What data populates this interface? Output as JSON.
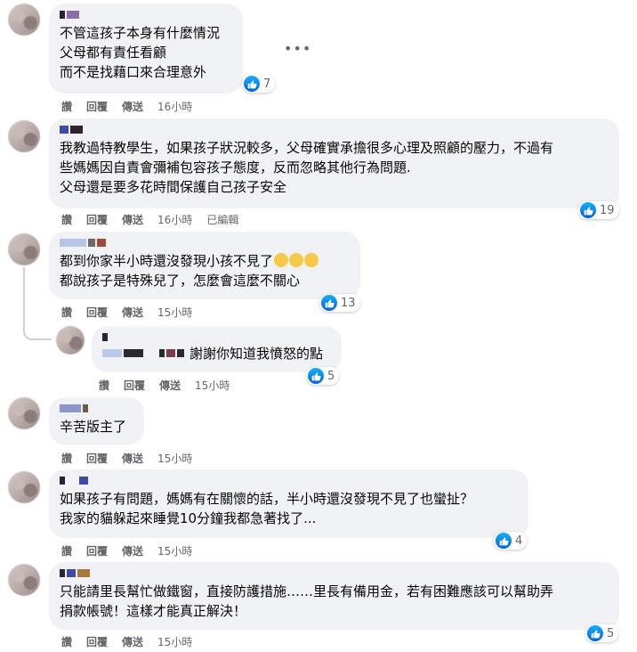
{
  "actions": {
    "like": "讚",
    "reply": "回覆",
    "share": "傳送",
    "edited": "已編輯"
  },
  "comments": [
    {
      "text": "不管這孩子本身有什麼情況\n父母都有責任看顧\n而不是找藉口來合理意外",
      "likes": "7",
      "time": "16小時"
    },
    {
      "text": "我教過特教學生，如果孩子狀況較多，父母確實承擔很多心理及照顧的壓力，不過有\n些媽媽因自責會彌補包容孩子態度，反而忽略其他行為問題.\n父母還是要多花時間保護自己孩子安全",
      "likes": "19",
      "time": "16小時"
    },
    {
      "text_line1": "都到你家半小時還沒發現小孩不見了",
      "text_line2": "都說孩子是特殊兒了，怎麼會這麼不關心",
      "likes": "13",
      "time": "15小時"
    },
    {
      "text": "謝謝你知道我憤怒的點",
      "likes": "5",
      "time": "15小時"
    },
    {
      "text": "辛苦版主了",
      "time": "15小時"
    },
    {
      "text": "如果孩子有問題，媽媽有在關懷的話，半小時還沒發現不見了也蠻扯？\n我家的貓躲起來睡覺10分鐘我都急著找了...",
      "likes": "4",
      "time": "15小時"
    },
    {
      "text": "只能請里長幫忙做鐵窗，直接防護措施……里長有備用金，若有困難應該可以幫助弄\n捐款帳號！這樣才能真正解決！",
      "likes": "5",
      "time": "15小時"
    }
  ],
  "more_icon": "more-horizontal-icon",
  "colors": {
    "bubble": "#f0f2f5",
    "like_blue": "#1877f2",
    "meta": "#65676b"
  }
}
